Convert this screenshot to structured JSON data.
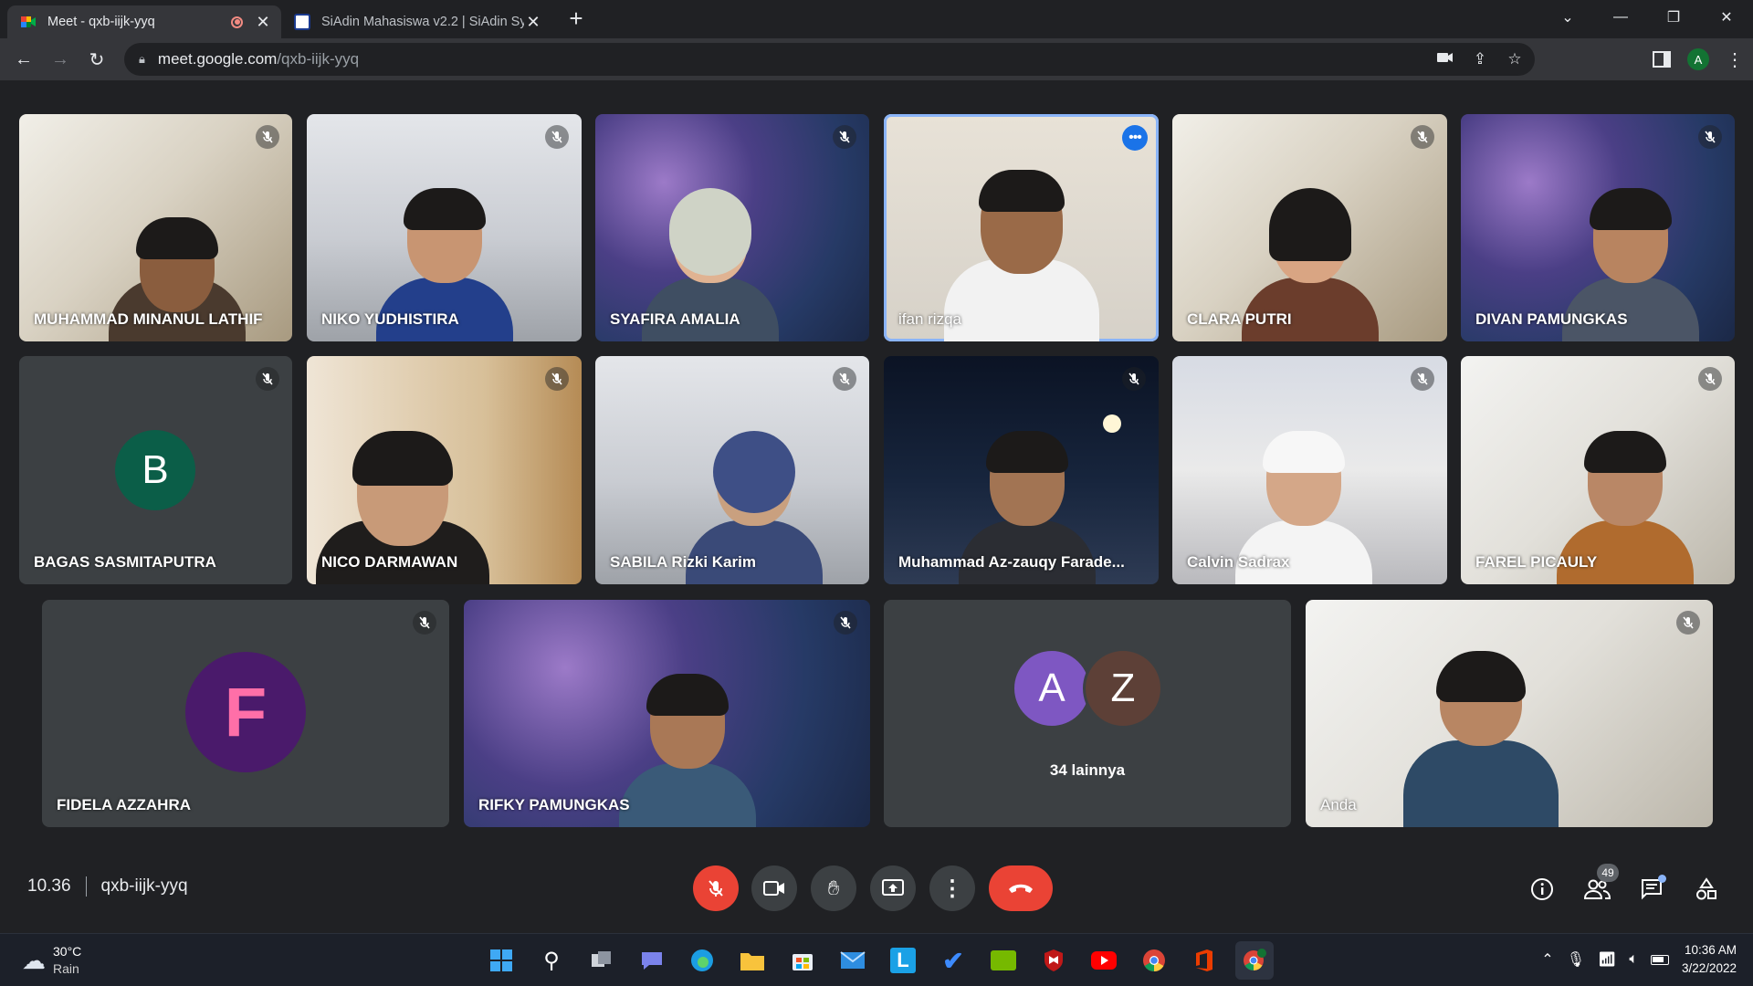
{
  "browser": {
    "tabs": [
      {
        "title": "Meet - qxb-iijk-yyq",
        "active": true,
        "recording": true
      },
      {
        "title": "SiAdin Mahasiswa v2.2 | SiAdin Sy",
        "active": false
      }
    ],
    "url_host": "meet.google.com",
    "url_path": "/qxb-iijk-yyq",
    "profile_initial": "A"
  },
  "meet": {
    "participants": [
      {
        "name": "MUHAMMAD MINANUL LATHIF",
        "muted": true
      },
      {
        "name": "NIKO YUDHISTIRA",
        "muted": true
      },
      {
        "name": "SYAFIRA AMALIA",
        "muted": true
      },
      {
        "name": "ifan rizqa",
        "muted": false,
        "speaking": true
      },
      {
        "name": "CLARA PUTRI",
        "muted": true
      },
      {
        "name": "DIVAN PAMUNGKAS",
        "muted": true
      },
      {
        "name": "BAGAS SASMITAPUTRA",
        "muted": true,
        "initial": "B",
        "avatar_color": "#0b5e48"
      },
      {
        "name": "NICO DARMAWAN",
        "muted": true
      },
      {
        "name": "SABILA Rizki Karim",
        "muted": true
      },
      {
        "name": "Muhammad Az-zauqy Farade...",
        "muted": true
      },
      {
        "name": "Calvin Sadrax",
        "muted": true
      },
      {
        "name": "FAREL PICAULY",
        "muted": true
      },
      {
        "name": "FIDELA AZZAHRA",
        "muted": true,
        "initial": "F",
        "avatar_color": "#4a1a6b"
      },
      {
        "name": "RIFKY PAMUNGKAS",
        "muted": true
      },
      {
        "name": "Anda",
        "muted": true
      }
    ],
    "others": {
      "initials": [
        "A",
        "Z"
      ],
      "colors": [
        "#7e57c2",
        "#5d4037"
      ],
      "label": "34 lainnya"
    },
    "time": "10.36",
    "meeting_code": "qxb-iijk-yyq",
    "people_count": "49"
  },
  "taskbar": {
    "temperature": "30°C",
    "condition": "Rain",
    "time": "10:36 AM",
    "date": "3/22/2022"
  }
}
